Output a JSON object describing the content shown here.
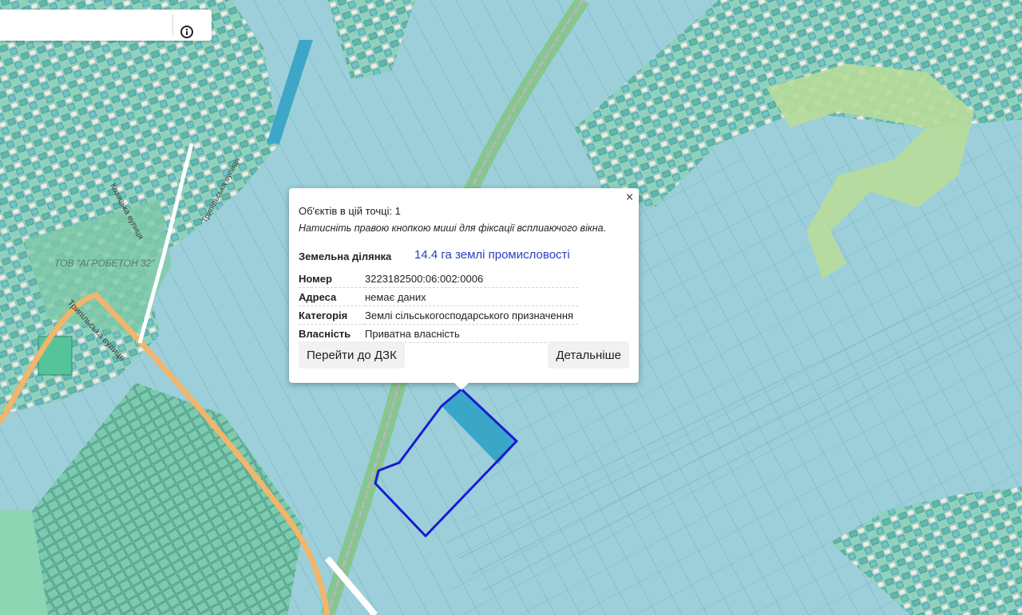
{
  "search": {
    "value": "",
    "placeholder": ""
  },
  "map_labels": {
    "company": "ТОВ \"АГРОБЕТОН 32\"",
    "street_trypilska": "Трипільська вулиця",
    "street_trypilska_2": "Трипільська вулиця",
    "street_kozatska": "Козацька вулиця"
  },
  "popup": {
    "close_label": "×",
    "objects_count": "Об'єктів в цій точці: 1",
    "hint": "Натисніть правою кнопкою миші для фіксації всплиаючого вікна.",
    "title_label": "Земельна ділянка",
    "title_value": "14.4 га землі промисловості",
    "rows": [
      {
        "key": "Номер",
        "value": "3223182500:06:002:0006"
      },
      {
        "key": "Адреса",
        "value": "немає даних"
      },
      {
        "key": "Категорія",
        "value": "Землі сільськогосподарського призначення"
      },
      {
        "key": "Власність",
        "value": "Приватна власність"
      }
    ],
    "btn_dzk": "Перейти до ДЗК",
    "btn_details": "Детальніше"
  },
  "colors": {
    "parcel_fill": "#9ccfd9",
    "parcel_stroke": "#5e98a6",
    "residential_green": "#6fc7a8",
    "wooded": "#b8dc9a",
    "road_orange": "#f2b56b",
    "rail_green": "#86c690",
    "highlight_outline": "#1a1ad6",
    "highlight_fill": "#3aa7c9"
  }
}
